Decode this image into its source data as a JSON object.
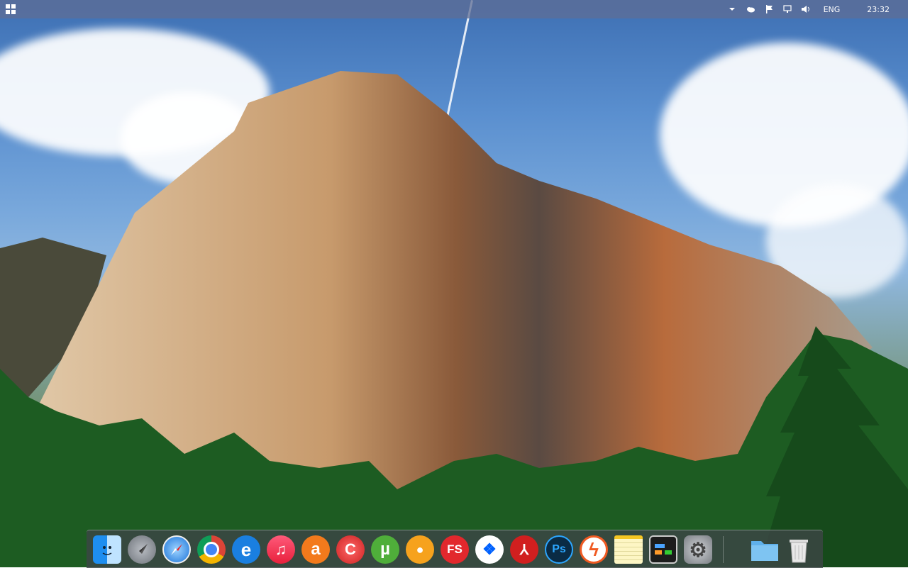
{
  "taskbar": {
    "start_icon": "windows-logo-icon",
    "tray_icons": [
      "chevron-up-icon",
      "onedrive-cloud-icon",
      "flag-icon",
      "network-icon",
      "volume-icon"
    ],
    "language": "ENG",
    "clock": "23:32"
  },
  "wallpaper": {
    "description_icon": "el-capitan-wallpaper",
    "colors": {
      "sky": "#5a8fcf",
      "rock": "#b8845a",
      "trees": "#1f5a24"
    }
  },
  "dock": {
    "items": [
      {
        "name": "finder",
        "icon": "finder-icon"
      },
      {
        "name": "launchpad",
        "icon": "rocket-icon"
      },
      {
        "name": "safari",
        "icon": "compass-icon"
      },
      {
        "name": "chrome",
        "icon": "chrome-icon"
      },
      {
        "name": "internet-explorer",
        "icon": "ie-icon",
        "label": "e"
      },
      {
        "name": "itunes",
        "icon": "music-note-icon",
        "label": "♫"
      },
      {
        "name": "avast",
        "icon": "avast-icon",
        "label": "a"
      },
      {
        "name": "ccleaner",
        "icon": "ccleaner-icon",
        "label": "C"
      },
      {
        "name": "utorrent",
        "icon": "utorrent-icon",
        "label": "µ"
      },
      {
        "name": "gom-player",
        "icon": "gom-icon",
        "label": "●"
      },
      {
        "name": "faststone",
        "icon": "faststone-icon",
        "label": "FS"
      },
      {
        "name": "dropbox",
        "icon": "dropbox-icon",
        "label": "❖"
      },
      {
        "name": "acrobat",
        "icon": "acrobat-icon",
        "label": "⅄"
      },
      {
        "name": "photoshop",
        "icon": "photoshop-icon",
        "label": "Ps"
      },
      {
        "name": "winamp",
        "icon": "lightning-icon",
        "label": "ϟ"
      },
      {
        "name": "notes",
        "icon": "notepad-icon"
      },
      {
        "name": "task-manager",
        "icon": "monitor-icon"
      },
      {
        "name": "system-preferences",
        "icon": "gear-icon",
        "label": "⚙"
      },
      {
        "name": "folder",
        "icon": "folder-icon"
      },
      {
        "name": "trash",
        "icon": "trash-icon"
      }
    ]
  }
}
